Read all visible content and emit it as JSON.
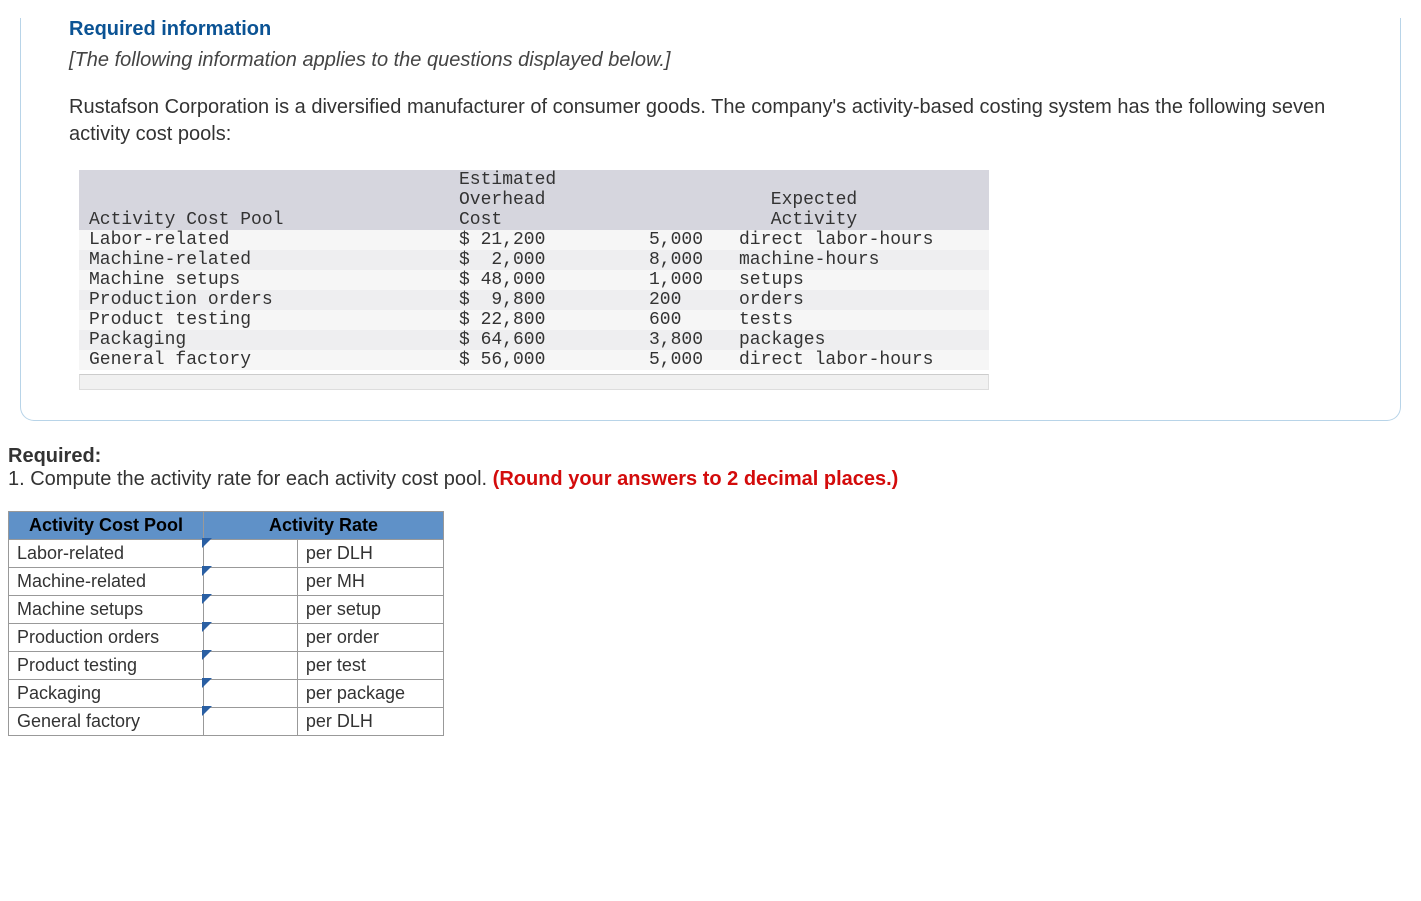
{
  "info": {
    "heading": "Required information",
    "note": "[The following information applies to the questions displayed below.]",
    "body": "Rustafson Corporation is a diversified manufacturer of consumer goods. The company's activity-based costing system has the following seven activity cost pools:"
  },
  "dataTable": {
    "h_pool": "Activity Cost Pool",
    "h_cost_l1": "Estimated",
    "h_cost_l2": "Overhead",
    "h_cost_l3": "Cost",
    "h_act_l1": "Expected",
    "h_act_l2": "Activity",
    "rows": [
      {
        "pool": "Labor-related",
        "cost": "$ 21,200",
        "qty": "5,000",
        "unit": "direct labor-hours"
      },
      {
        "pool": "Machine-related",
        "cost": "$  2,000",
        "qty": "8,000",
        "unit": "machine-hours"
      },
      {
        "pool": "Machine setups",
        "cost": "$ 48,000",
        "qty": "1,000",
        "unit": "setups"
      },
      {
        "pool": "Production orders",
        "cost": "$  9,800",
        "qty": "200",
        "unit": "orders"
      },
      {
        "pool": "Product testing",
        "cost": "$ 22,800",
        "qty": "600",
        "unit": "tests"
      },
      {
        "pool": "Packaging",
        "cost": "$ 64,600",
        "qty": "3,800",
        "unit": "packages"
      },
      {
        "pool": "General factory",
        "cost": "$ 56,000",
        "qty": "5,000",
        "unit": "direct labor-hours"
      }
    ]
  },
  "required": {
    "label": "Required:",
    "q1": "1. Compute the activity rate for each activity cost pool. ",
    "q1_red": "(Round your answers to 2 decimal places.)"
  },
  "answerTable": {
    "h_pool": "Activity Cost Pool",
    "h_rate": "Activity Rate",
    "rows": [
      {
        "pool": "Labor-related",
        "unit": "per DLH"
      },
      {
        "pool": "Machine-related",
        "unit": "per MH"
      },
      {
        "pool": "Machine setups",
        "unit": "per setup"
      },
      {
        "pool": "Production orders",
        "unit": "per order"
      },
      {
        "pool": "Product testing",
        "unit": "per test"
      },
      {
        "pool": "Packaging",
        "unit": "per package"
      },
      {
        "pool": "General factory",
        "unit": "per DLH"
      }
    ]
  }
}
